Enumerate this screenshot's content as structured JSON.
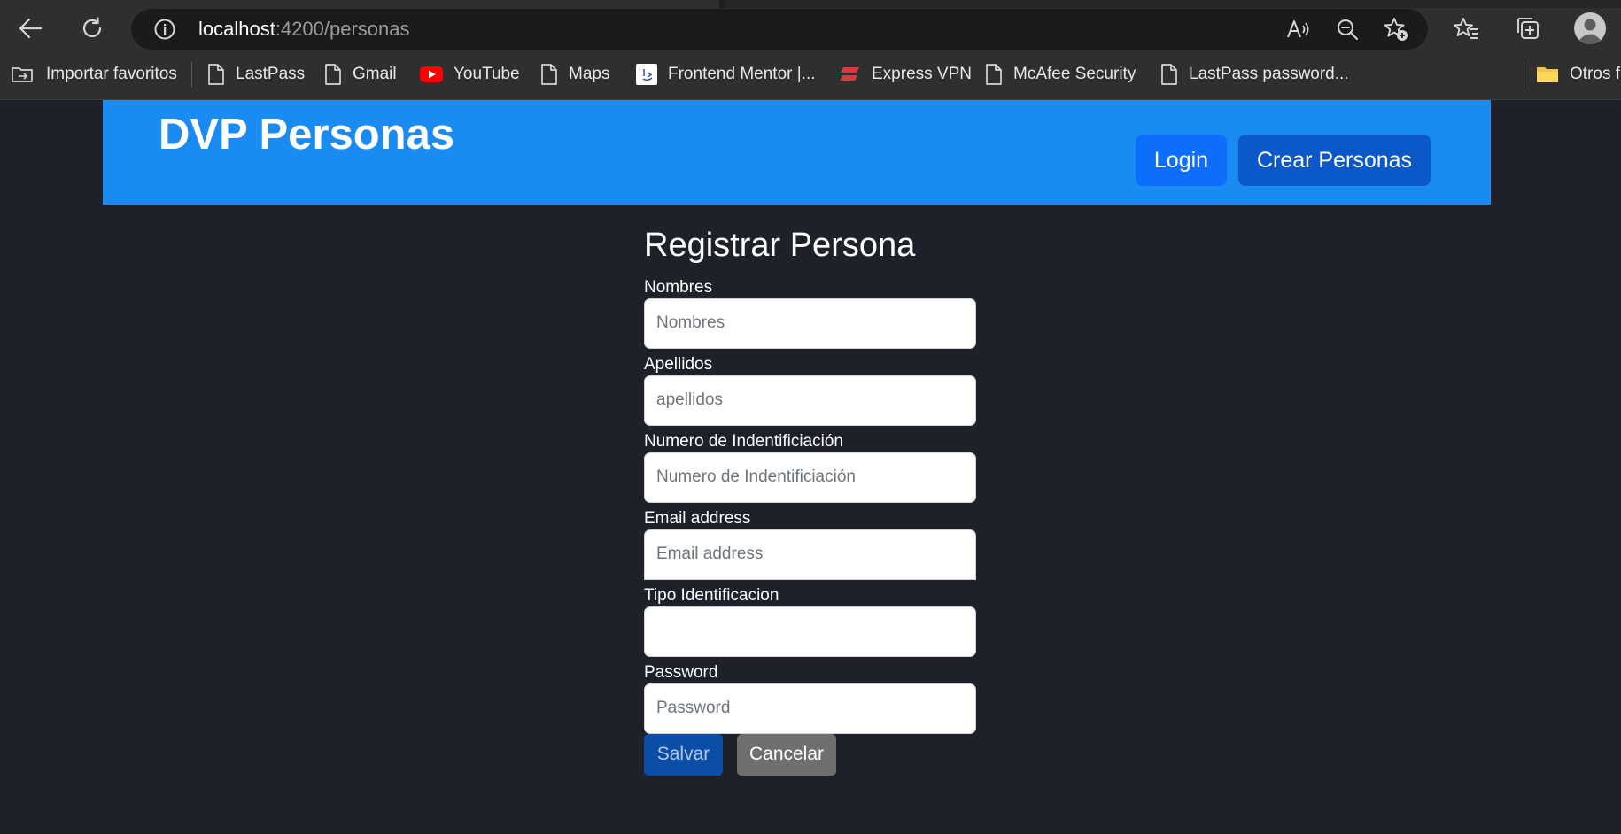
{
  "browser": {
    "url_host": "localhost",
    "url_path": ":4200/personas",
    "bookmarks": [
      {
        "label": "Importar favoritos",
        "icon": "import-favorites-icon"
      },
      {
        "label": "LastPass",
        "icon": "page-icon"
      },
      {
        "label": "Gmail",
        "icon": "page-icon"
      },
      {
        "label": "YouTube",
        "icon": "youtube-icon"
      },
      {
        "label": "Maps",
        "icon": "page-icon"
      },
      {
        "label": "Frontend Mentor |...",
        "icon": "frontend-mentor-icon"
      },
      {
        "label": "Express VPN",
        "icon": "expressvpn-icon"
      },
      {
        "label": "McAfee Security",
        "icon": "page-icon"
      },
      {
        "label": "LastPass password...",
        "icon": "page-icon"
      },
      {
        "label": "Otros f",
        "icon": "folder-icon"
      }
    ]
  },
  "navbar": {
    "brand": "DVP Personas",
    "login_label": "Login",
    "crear_label": "Crear Personas",
    "color": "#1a8bf3"
  },
  "form": {
    "title": "Registrar Persona",
    "fields": [
      {
        "label": "Nombres",
        "placeholder": "Nombres",
        "value": ""
      },
      {
        "label": "Apellidos",
        "placeholder": "apellidos",
        "value": ""
      },
      {
        "label": "Numero de Indentificiación",
        "placeholder": "Numero de Indentificiación",
        "value": ""
      },
      {
        "label": "Email address",
        "placeholder": "Email address",
        "value": ""
      },
      {
        "label": "Tipo Identificacion",
        "placeholder": "",
        "value": ""
      },
      {
        "label": "Password",
        "placeholder": "Password",
        "value": ""
      }
    ],
    "save_label": "Salvar",
    "cancel_label": "Cancelar"
  },
  "colors": {
    "page_background": "#1e202a",
    "primary": "#0d6efd",
    "secondary": "#6f6f6f"
  }
}
